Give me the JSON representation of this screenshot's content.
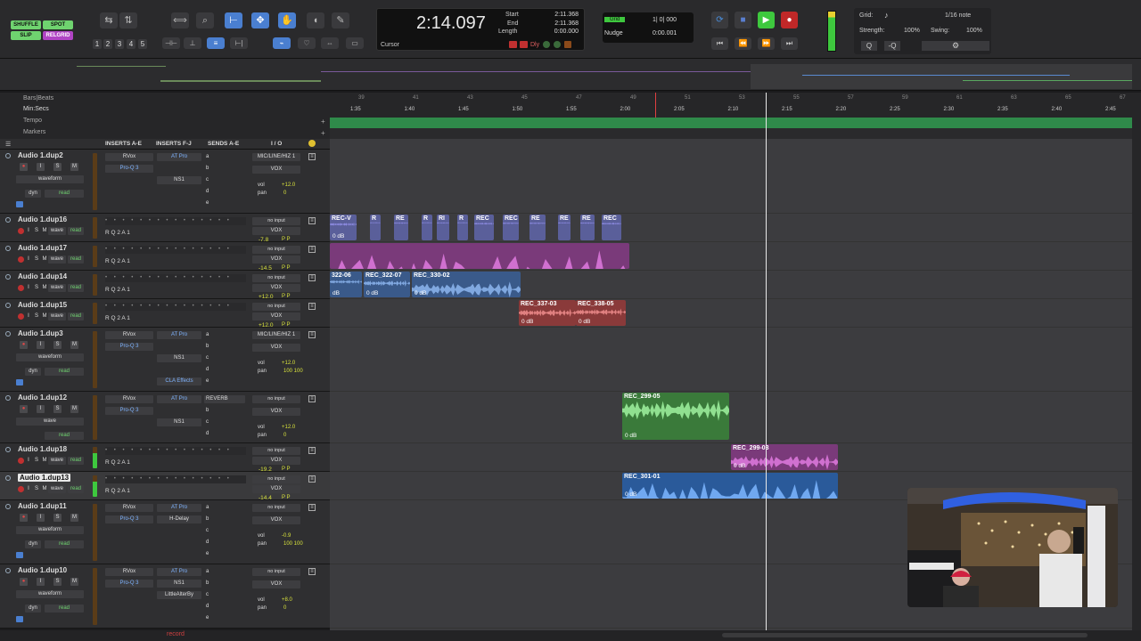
{
  "edit_modes": [
    "SHUFFLE",
    "SPOT",
    "SLIP",
    "RELGRID"
  ],
  "numkeys": [
    "1",
    "2",
    "3",
    "4",
    "5"
  ],
  "counter": {
    "main": "2:14.097",
    "start_label": "Start",
    "start": "2:11.368",
    "end_label": "End",
    "end": "2:11.368",
    "length_label": "Length",
    "length": "0:00.000",
    "cursor_label": "Cursor",
    "dly_label": "Dly"
  },
  "grid": {
    "grid_label": "Grid",
    "grid_value": "1| 0| 000",
    "nudge_label": "Nudge",
    "nudge_value": "0:00.001"
  },
  "groove": {
    "grid_label": "Grid:",
    "grid_value": "1/16 note",
    "strength_label": "Strength:",
    "strength": "100%",
    "swing_label": "Swing:",
    "swing": "100%"
  },
  "rulers": {
    "bars": "Bars|Beats",
    "minsecs": "Min:Secs",
    "tempo": "Tempo",
    "markers": "Markers",
    "bar_ticks": [
      "39",
      "41",
      "43",
      "45",
      "47",
      "49",
      "51",
      "53",
      "55",
      "57",
      "59",
      "61",
      "63",
      "65",
      "67"
    ],
    "time_ticks": [
      "1:35",
      "1:40",
      "1:45",
      "1:50",
      "1:55",
      "2:00",
      "2:05",
      "2:10",
      "2:15",
      "2:20",
      "2:25",
      "2:30",
      "2:35",
      "2:40",
      "2:45"
    ]
  },
  "columns": {
    "inserts_ae": "INSERTS A-E",
    "inserts_fj": "INSERTS F-J",
    "sends_ae": "SENDS A-E",
    "io": "I / O"
  },
  "tracks": [
    {
      "name": "Audio 1.dup2",
      "view": "waveform",
      "auto": "read",
      "dyn": "dyn",
      "ins": [
        "RVox",
        "Pro-Q 3",
        "",
        "",
        ""
      ],
      "insfj": [
        "AT Pro",
        "",
        "NS1",
        "",
        ""
      ],
      "sends": [
        "a",
        "b",
        "c",
        "d",
        "e"
      ],
      "in": "MIC/LINE/HIZ 1",
      "out": "VOX",
      "vol": "+12.0",
      "pan": "0"
    },
    {
      "name": "Audio 1.dup16",
      "view": "wave",
      "auto": "read",
      "in": "no input",
      "out": "VOX",
      "vol": "-7.8"
    },
    {
      "name": "Audio 1.dup17",
      "view": "wave",
      "auto": "read",
      "in": "no input",
      "out": "VOX",
      "vol": "-14.5"
    },
    {
      "name": "Audio 1.dup14",
      "view": "wave",
      "auto": "read",
      "in": "no input",
      "out": "VOX",
      "vol": "+12.0"
    },
    {
      "name": "Audio 1.dup15",
      "view": "wave",
      "auto": "read",
      "in": "no input",
      "out": "VOX",
      "vol": "+12.0"
    },
    {
      "name": "Audio 1.dup3",
      "view": "waveform",
      "auto": "read",
      "dyn": "dyn",
      "ins": [
        "RVox",
        "Pro-Q 3",
        "",
        "",
        ""
      ],
      "insfj": [
        "AT Pro",
        "",
        "NS1",
        "",
        "CLA Effects"
      ],
      "sends": [
        "a",
        "b",
        "c",
        "d",
        "e"
      ],
      "in": "MIC/LINE/HIZ 1",
      "out": "VOX",
      "vol": "+12.0",
      "pan": "100 100"
    },
    {
      "name": "Audio 1.dup12",
      "view": "wave",
      "auto": "read",
      "ins": [
        "RVox",
        "Pro-Q 3",
        "",
        "",
        ""
      ],
      "insfj": [
        "AT Pro",
        "",
        "NS1",
        "",
        ""
      ],
      "sends": [
        "REVERB",
        "b",
        "c",
        "d",
        ""
      ],
      "in": "no input",
      "out": "VOX",
      "vol": "+12.0",
      "pan": "0"
    },
    {
      "name": "Audio 1.dup18",
      "view": "wave",
      "auto": "read",
      "in": "no input",
      "out": "VOX",
      "vol": "-19.2"
    },
    {
      "name": "Audio 1.dup13",
      "view": "wave",
      "auto": "read",
      "in": "no input",
      "out": "VOX",
      "vol": "-14.4"
    },
    {
      "name": "Audio 1.dup11",
      "view": "waveform",
      "auto": "read",
      "dyn": "dyn",
      "ins": [
        "RVox",
        "Pro-Q 3",
        "",
        "",
        ""
      ],
      "insfj": [
        "AT Pro",
        "H-Delay",
        "",
        "",
        ""
      ],
      "sends": [
        "a",
        "b",
        "c",
        "d",
        "e"
      ],
      "in": "no input",
      "out": "VOX",
      "vol": "-0.9",
      "pan": "100 100"
    },
    {
      "name": "Audio 1.dup10",
      "view": "waveform",
      "auto": "read",
      "dyn": "dyn",
      "ins": [
        "RVox",
        "Pro-Q 3",
        "",
        "",
        ""
      ],
      "insfj": [
        "AT Pro",
        "NS1",
        "LittleAlterBy",
        "",
        ""
      ],
      "sends": [
        "a",
        "b",
        "c",
        "d",
        "e"
      ],
      "in": "no input",
      "out": "VOX",
      "vol": "+8.0",
      "pan": "0"
    }
  ],
  "clips": {
    "dup16": [
      "REC-V",
      "R",
      "RE",
      "R",
      "RI",
      "R",
      "REC",
      "REC",
      "RE",
      "RE",
      "RE",
      "REC"
    ],
    "dup14": [
      "322-06",
      "REC_322-07",
      "REC_330-02"
    ],
    "dup15": [
      "REC_337-03",
      "REC_338-05"
    ],
    "dup12": [
      "REC_299-05"
    ],
    "dup18": [
      "REC_299-03"
    ],
    "dup13": [
      "REC_301-01"
    ],
    "gain": "0 dB",
    "gain_short": "dB"
  },
  "status": {
    "record": "record"
  },
  "colors": {
    "blue": "#5a6fc8",
    "purple": "#a04aa8",
    "green": "#5aa860",
    "red": "#b84848",
    "steel": "#4a78b8",
    "cursor": "#e8e8e8"
  }
}
